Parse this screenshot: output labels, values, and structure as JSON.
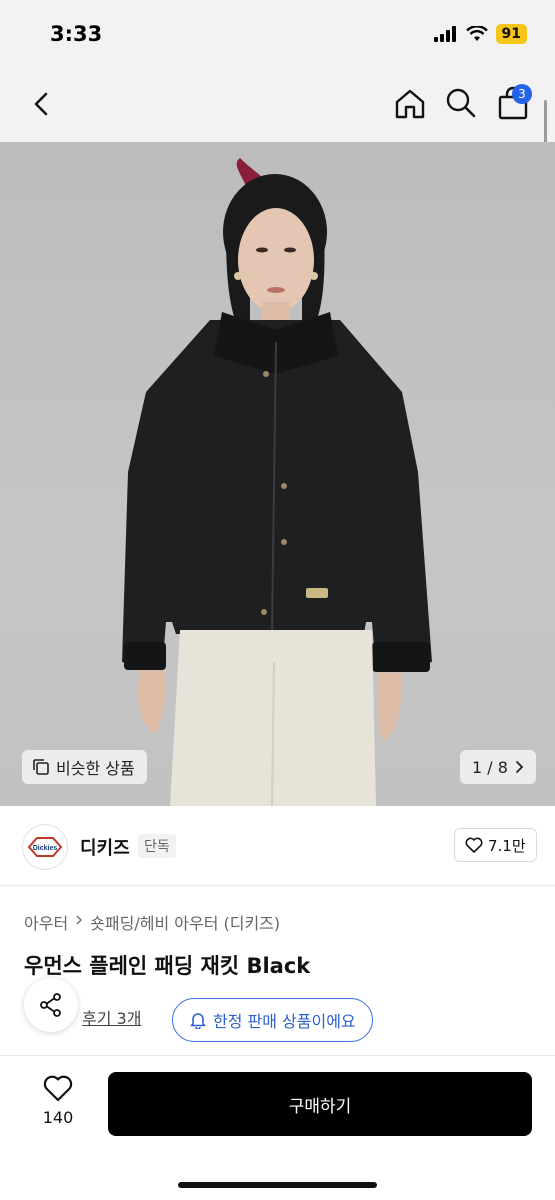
{
  "status_bar": {
    "time": "3:33",
    "battery": "91"
  },
  "nav": {
    "cart_badge": "3"
  },
  "gallery": {
    "similar_label": "비슷한 상품",
    "page_indicator": "1 / 8"
  },
  "brand": {
    "name": "디키즈",
    "tag": "단독",
    "likes": "7.1만",
    "logo_text": "Dickies"
  },
  "breadcrumb": {
    "category": "아우터",
    "subcategory": "숏패딩/헤비 아우터 (디키즈)"
  },
  "product": {
    "title": "우먼스 플레인 패딩 재킷 Black"
  },
  "reviews": {
    "label": "후기 3개"
  },
  "limited": {
    "label": "한정 판매 상품이에요"
  },
  "bottom": {
    "wish_count": "140",
    "buy_label": "구매하기"
  },
  "colors": {
    "accent": "#2563eb",
    "primary": "#000000"
  },
  "icons": [
    "back-icon",
    "home-icon",
    "search-icon",
    "cart-icon",
    "copy-icon",
    "chevron-right-icon",
    "heart-icon",
    "share-icon",
    "bell-icon"
  ]
}
